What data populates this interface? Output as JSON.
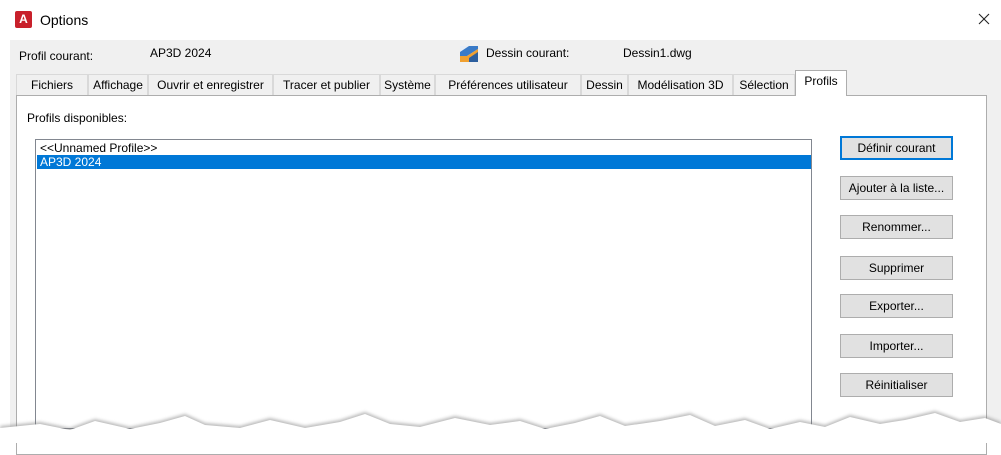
{
  "window": {
    "title": "Options",
    "app_icon_letter": "A"
  },
  "header": {
    "current_profile_label": "Profil courant:",
    "current_profile_value": "AP3D 2024",
    "current_drawing_label": "Dessin courant:",
    "current_drawing_value": "Dessin1.dwg"
  },
  "tabs": [
    {
      "label": "Fichiers"
    },
    {
      "label": "Affichage"
    },
    {
      "label": "Ouvrir et enregistrer"
    },
    {
      "label": "Tracer et publier"
    },
    {
      "label": "Système"
    },
    {
      "label": "Préférences utilisateur"
    },
    {
      "label": "Dessin"
    },
    {
      "label": "Modélisation 3D"
    },
    {
      "label": "Sélection"
    },
    {
      "label": "Profils",
      "active": true
    }
  ],
  "profiles": {
    "label": "Profils disponibles:",
    "items": [
      {
        "label": "<<Unnamed Profile>>"
      },
      {
        "label": "AP3D 2024",
        "selected": true
      }
    ]
  },
  "buttons": {
    "set_current": "Définir courant",
    "add_to_list": "Ajouter à la liste...",
    "rename": "Renommer...",
    "delete": "Supprimer",
    "export": "Exporter...",
    "import": "Importer...",
    "reset": "Réinitialiser"
  },
  "colors": {
    "selection": "#0078d7",
    "dialog_bg": "#f0f0f0",
    "app_icon": "#c8202b"
  }
}
